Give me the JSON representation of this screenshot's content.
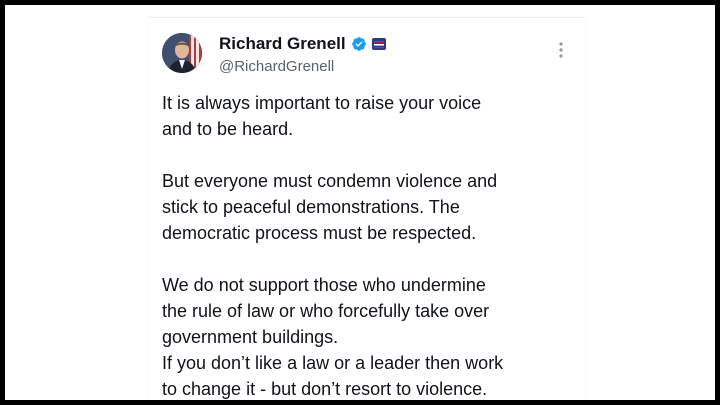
{
  "tweet": {
    "author_name": "Richard Grenell",
    "author_handle": "@RichardGrenell",
    "verified_icon": "verified-badge-icon",
    "affiliate_icon": "affiliate-flag-icon",
    "more_icon": "more-options-icon",
    "body": "It is always important to raise your voice\nand to be heard.\n\nBut everyone must condemn violence and\nstick to peaceful demonstrations. The\ndemocratic process must be respected.\n\nWe do not support those who undermine\nthe rule of law or who forcefully take over\ngovernment buildings.\nIf you don’t like a law or a leader then work\nto change it - but don’t resort to violence."
  },
  "colors": {
    "text": "#0f1419",
    "secondary": "#536471",
    "verified": "#1d9bf0",
    "frame": "#000000"
  }
}
